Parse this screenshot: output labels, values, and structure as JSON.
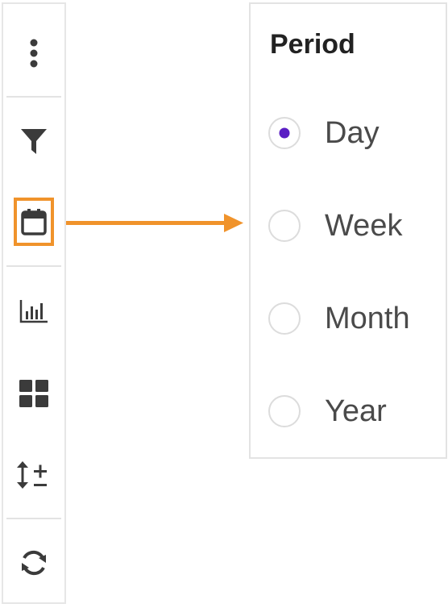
{
  "toolbar": {
    "tools": [
      {
        "name": "more-options-icon"
      },
      {
        "name": "filter-icon"
      },
      {
        "name": "calendar-icon",
        "highlighted": true
      },
      {
        "name": "bar-chart-icon"
      },
      {
        "name": "grid-view-icon"
      },
      {
        "name": "sort-order-icon"
      },
      {
        "name": "refresh-icon"
      }
    ]
  },
  "period_panel": {
    "title": "Period",
    "options": [
      {
        "label": "Day",
        "selected": true
      },
      {
        "label": "Week",
        "selected": false
      },
      {
        "label": "Month",
        "selected": false
      },
      {
        "label": "Year",
        "selected": false
      }
    ]
  },
  "colors": {
    "highlight": "#f0932b",
    "radio_selected": "#5a1ec4",
    "icon": "#3b3b3b"
  }
}
